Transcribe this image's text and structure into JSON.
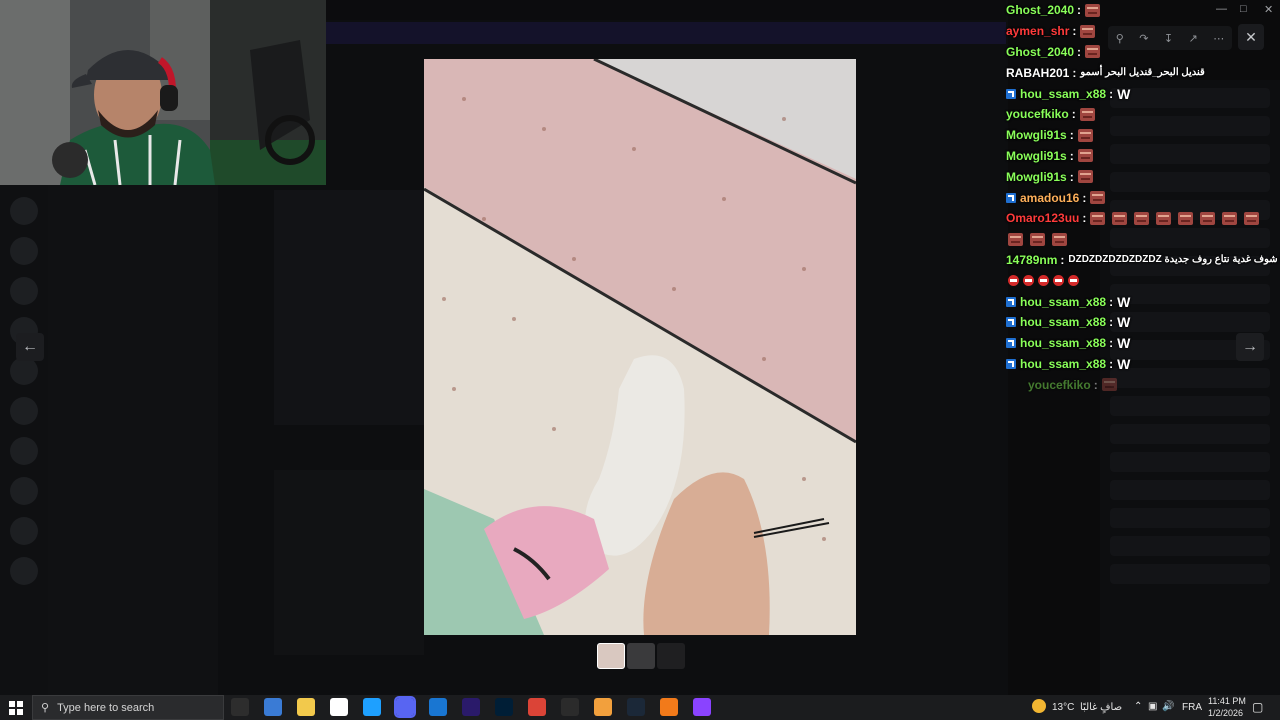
{
  "colors": {
    "accent": "#5865f2",
    "badge_blue": "#1f6fd1",
    "name_green": "#8aff5a",
    "name_red": "#ff3b3b",
    "name_white": "#ffffff"
  },
  "viewer": {
    "toolbar_icons": [
      "zoom-icon",
      "share-icon",
      "download-icon",
      "open-external-icon",
      "more-icon"
    ],
    "close_icon": "close-icon",
    "prev_icon": "arrow-left-icon",
    "next_icon": "arrow-right-icon",
    "thumbnail_count": 3
  },
  "chat": {
    "messages": [
      {
        "user": "Ghost_2040",
        "color": "#8aff5a",
        "badge": false,
        "content": "emotes",
        "emotes": [
          "brick"
        ]
      },
      {
        "user": "aymen_shr",
        "color": "#ff3b3b",
        "badge": false,
        "content": "emotes",
        "emotes": [
          "brick"
        ]
      },
      {
        "user": "Ghost_2040",
        "color": "#8aff5a",
        "badge": false,
        "content": "emotes",
        "emotes": [
          "brick"
        ]
      },
      {
        "user": "RABAH201",
        "color": "#ffffff",
        "badge": false,
        "content": "text",
        "text": "قنديل البحر_قنديل البحر أسمو"
      },
      {
        "user": "hou_ssam_x88",
        "color": "#8aff5a",
        "badge": true,
        "content": "w",
        "text": "W"
      },
      {
        "user": "youcefkiko",
        "color": "#8aff5a",
        "badge": false,
        "content": "emotes",
        "emotes": [
          "brick"
        ]
      },
      {
        "user": "Mowgli91s",
        "color": "#8aff5a",
        "badge": false,
        "content": "emotes",
        "emotes": [
          "brick"
        ]
      },
      {
        "user": "Mowgli91s",
        "color": "#8aff5a",
        "badge": false,
        "content": "emotes",
        "emotes": [
          "brick"
        ]
      },
      {
        "user": "Mowgli91s",
        "color": "#8aff5a",
        "badge": false,
        "content": "emotes",
        "emotes": [
          "brick"
        ]
      },
      {
        "user": "amadou16",
        "color": "#ffb05a",
        "badge": true,
        "content": "emotes",
        "emotes": [
          "brick"
        ]
      },
      {
        "user": "Omaro123uu",
        "color": "#ff3b3b",
        "badge": false,
        "content": "emotes",
        "emotes": [
          "brick",
          "brick",
          "brick",
          "brick",
          "brick",
          "brick",
          "brick",
          "brick"
        ],
        "continuation": [
          "brick",
          "brick",
          "brick"
        ]
      },
      {
        "user": "14789nm",
        "color": "#8aff5a",
        "badge": false,
        "content": "text",
        "text": "هوفا شوف غدية نتاع روف جديدة DZDZDZDZDZDZDZ",
        "continuation_stop": 5
      },
      {
        "user": "hou_ssam_x88",
        "color": "#8aff5a",
        "badge": true,
        "content": "w",
        "text": "W"
      },
      {
        "user": "hou_ssam_x88",
        "color": "#8aff5a",
        "badge": true,
        "content": "w",
        "text": "W"
      },
      {
        "user": "hou_ssam_x88",
        "color": "#8aff5a",
        "badge": true,
        "content": "w",
        "text": "W"
      },
      {
        "user": "hou_ssam_x88",
        "color": "#8aff5a",
        "badge": true,
        "content": "w",
        "text": "W"
      },
      {
        "user": "youcefkiko",
        "color": "#8aff5a",
        "badge": false,
        "content": "emotes",
        "emotes": [
          "brick"
        ],
        "faded": true
      }
    ]
  },
  "taskbar": {
    "search_placeholder": "Type here to search",
    "weather_temp": "13°C",
    "weather_desc": "صافٍ غالبًا",
    "language": "FRA",
    "time": "11:41 PM",
    "date": "1/2/2026",
    "apps": [
      "task-view-icon",
      "microsoft-store-icon",
      "file-explorer-icon",
      "notepad-icon",
      "edge-icon",
      "discord-icon",
      "outlook-icon",
      "premiere-icon",
      "photoshop-icon",
      "chrome-icon",
      "obs-icon",
      "app-icon",
      "steam-icon",
      "vlc-icon",
      "twitch-icon"
    ]
  }
}
